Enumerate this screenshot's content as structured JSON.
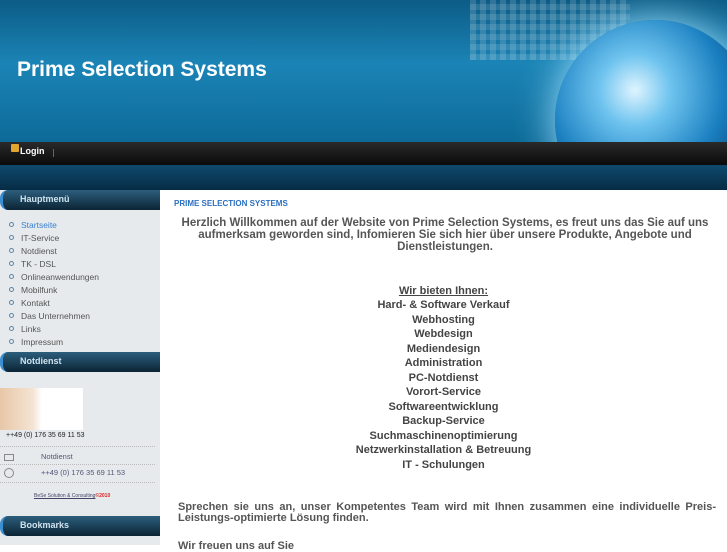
{
  "header": {
    "title": "Prime Selection Systems",
    "login": "Login"
  },
  "sidebar": {
    "menu_title": "Hauptmenü",
    "menu": [
      "Startseite",
      "IT-Service",
      "Notdienst",
      "TK - DSL",
      "Onlineanwendungen",
      "Mobilfunk",
      "Kontakt",
      "Das Unternehmen",
      "Links",
      "Impressum"
    ],
    "notdienst_title": "Notdienst",
    "phone": "++49 (0) 176 35 69 11 53",
    "email_link": "Notdienst",
    "phone2": "++49 (0) 176 35 69 11 53",
    "credit": "BeSe Solution & Consulting",
    "credit_year": "©2010",
    "bookmarks_title": "Bookmarks"
  },
  "main": {
    "breadcrumb": "PRIME SELECTION SYSTEMS",
    "welcome": "Herzlich Willkommen auf der Website von Prime Selection Systems, es freut uns das Sie auf uns aufmerksam geworden sind, Infomieren Sie sich hier über unsere Produkte, Angebote und Dienstleistungen.",
    "offer_title": "Wir bieten Ihnen:",
    "offers": [
      "Hard- & Software Verkauf",
      "Webhosting",
      "Webdesign",
      "Mediendesign",
      "Administration",
      "PC-Notdienst",
      "Vorort-Service",
      "Softwareentwicklung",
      "Backup-Service",
      "Suchmaschinenoptimierung",
      "Netzwerkinstallation & Betreuung",
      "IT - Schulungen"
    ],
    "contact": "Sprechen sie uns an, unser Kompetentes Team wird mit Ihnen zusammen eine individuelle Preis-Leistungs-optimierte Lösung finden.",
    "closing": "Wir freuen uns auf Sie"
  }
}
